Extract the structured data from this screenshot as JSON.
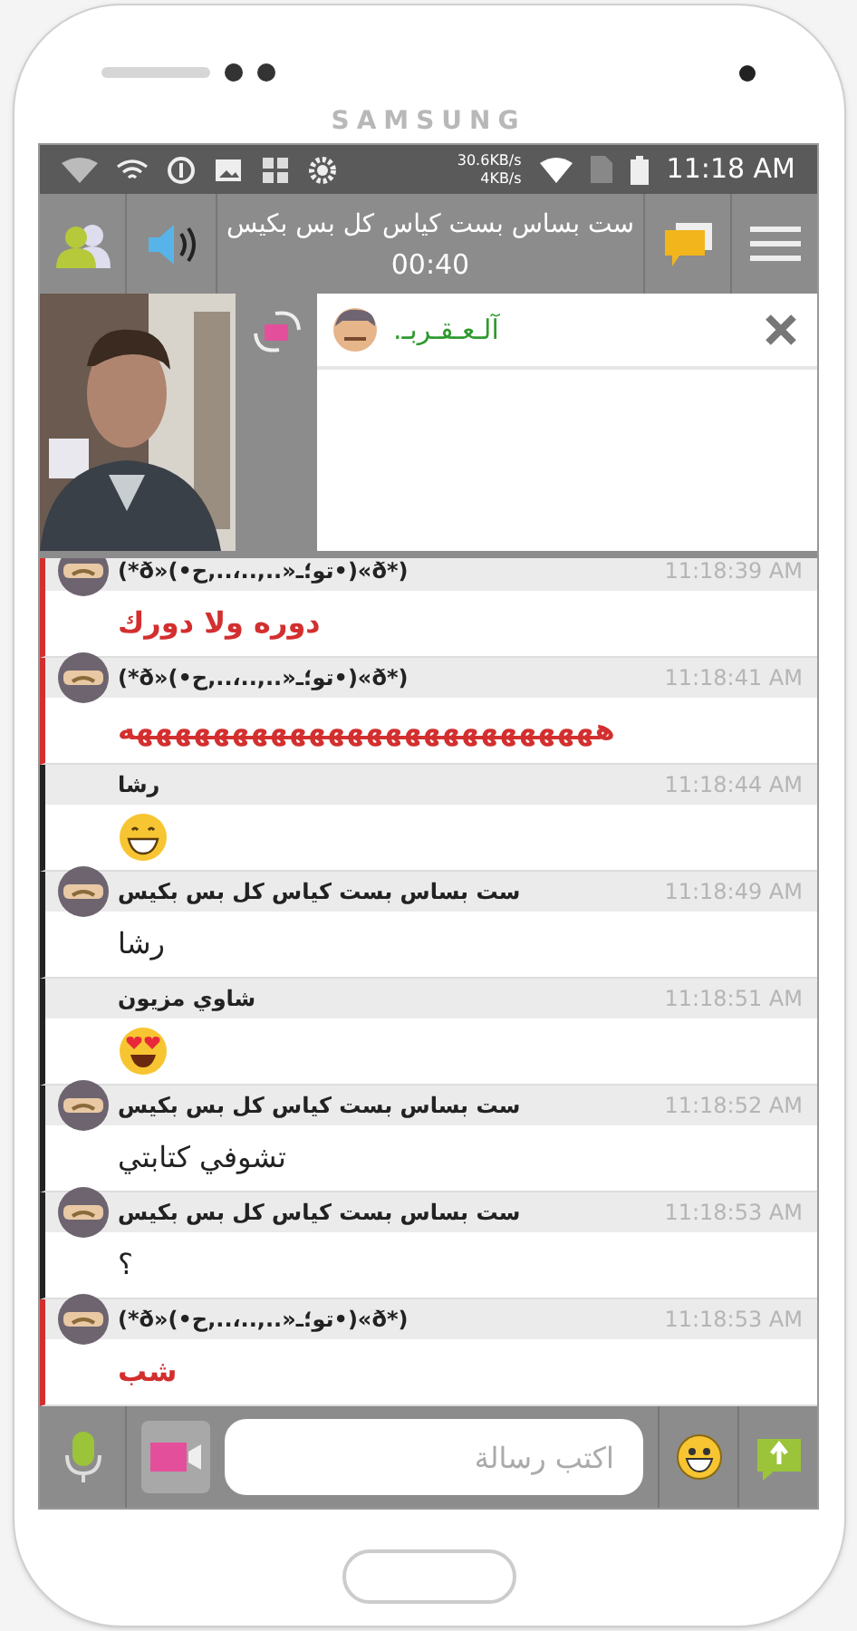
{
  "device": {
    "brand": "SAMSUNG"
  },
  "status_bar": {
    "speed_down": "30.6KB/s",
    "speed_up": "4KB/s",
    "time": "11:18 AM"
  },
  "toolbar": {
    "title": "ست بساس بست كياس كل بس بكيس",
    "timer": "00:40"
  },
  "call_panel": {
    "name": "آلـعـقـربـ."
  },
  "messages": [
    {
      "sender": "(*ð»(•تو؛ـ«..,..،..,ح•)«ð*)",
      "time": "11:18:39 AM",
      "kind": "text",
      "text": "دوره ولا دورك",
      "avatar": true,
      "color": "#d32f2f"
    },
    {
      "sender": "(*ð»(•تو؛ـ«..,..،..,ح•)«ð*)",
      "time": "11:18:41 AM",
      "kind": "text",
      "text": "هههههههههههههههههههههههههه",
      "avatar": true,
      "color": "#d32f2f"
    },
    {
      "sender": "رشا",
      "time": "11:18:44 AM",
      "kind": "grin",
      "avatar": false,
      "color": "#222222"
    },
    {
      "sender": "ست بساس بست كياس كل بس بكيس",
      "time": "11:18:49 AM",
      "kind": "text",
      "text": "رشا",
      "avatar": true,
      "color": "#222222"
    },
    {
      "sender": "شاوي مزيون",
      "time": "11:18:51 AM",
      "kind": "hearts",
      "avatar": false,
      "color": "#222222"
    },
    {
      "sender": "ست بساس بست كياس كل بس بكيس",
      "time": "11:18:52 AM",
      "kind": "text",
      "text": "تشوفي كتابتي",
      "avatar": true,
      "color": "#222222"
    },
    {
      "sender": "ست بساس بست كياس كل بس بكيس",
      "time": "11:18:53 AM",
      "kind": "text",
      "text": "؟",
      "avatar": true,
      "color": "#222222"
    },
    {
      "sender": "(*ð»(•تو؛ـ«..,..،..,ح•)«ð*)",
      "time": "11:18:53 AM",
      "kind": "text",
      "text": "شب",
      "avatar": true,
      "color": "#d32f2f"
    }
  ],
  "composer": {
    "placeholder": "اكتب رسالة"
  }
}
